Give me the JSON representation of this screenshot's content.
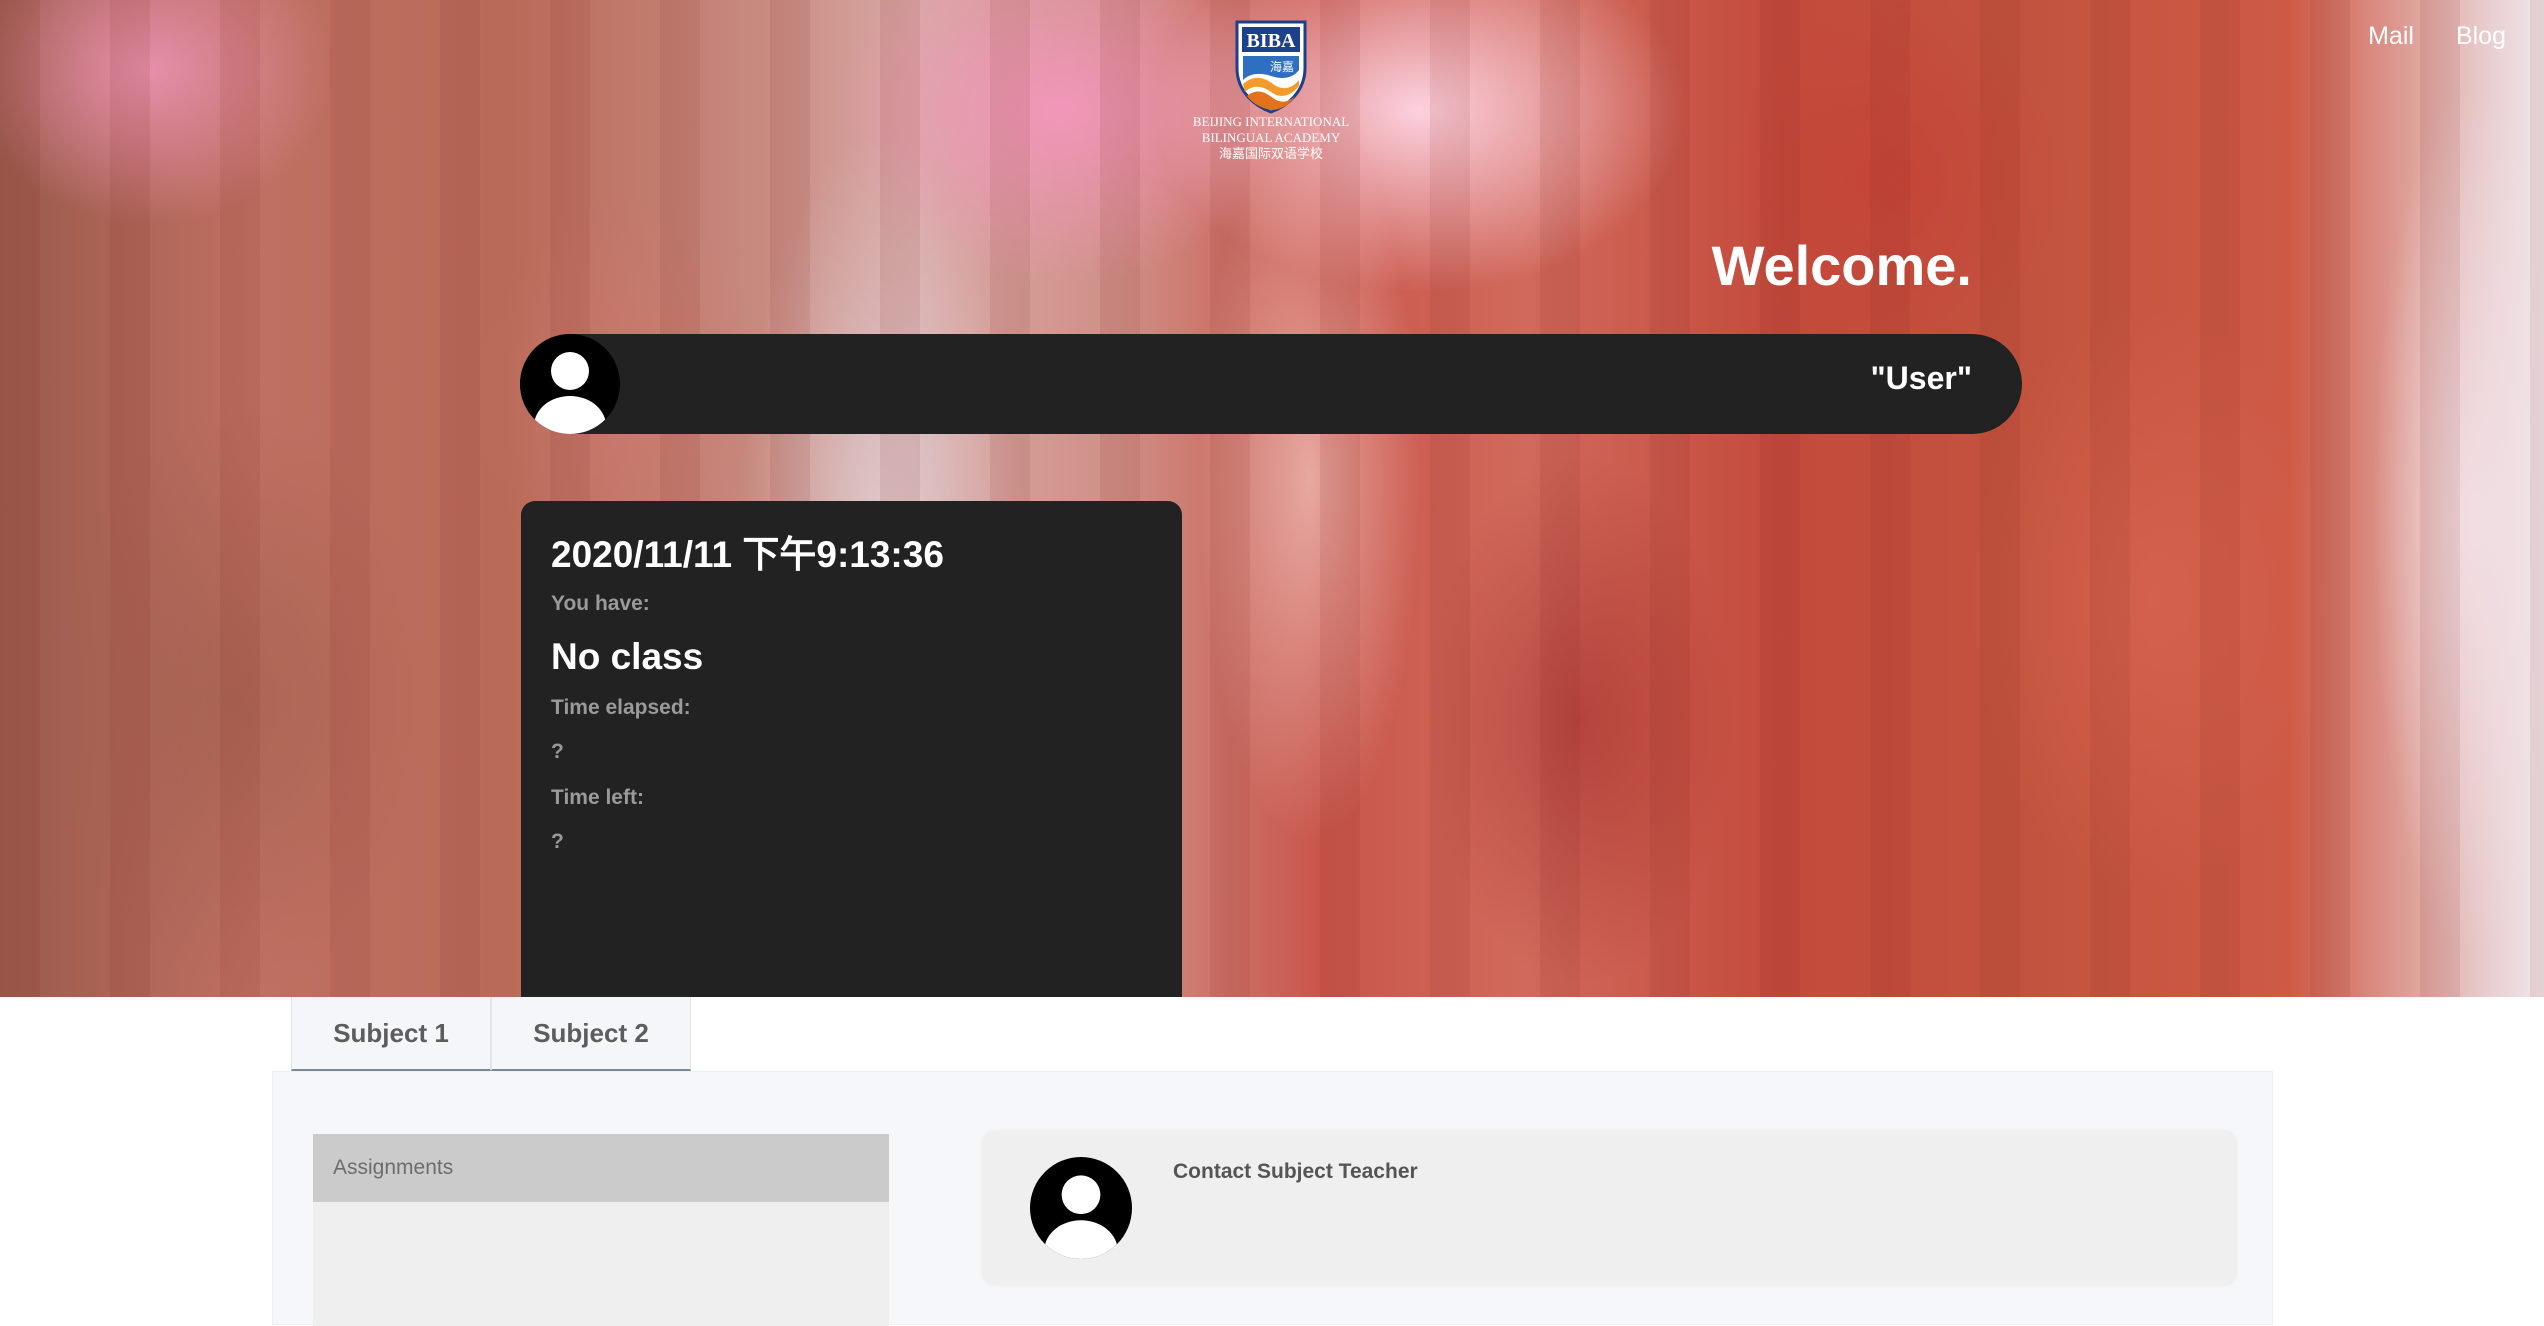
{
  "header": {
    "logo": {
      "mark": "BIBA",
      "mark_cn": "海嘉",
      "line1": "BEIJING INTERNATIONAL",
      "line2": "BILINGUAL ACADEMY",
      "line3": "海嘉国际双语学校"
    },
    "nav": [
      {
        "label": "Mail",
        "icon": "mail-link"
      },
      {
        "label": "Blog",
        "icon": "blog-link"
      }
    ]
  },
  "hero": {
    "welcome": "Welcome.",
    "user_name": "\"User\"",
    "avatar_icon": "user-avatar-icon"
  },
  "schedule_card": {
    "datetime": "2020/11/11 下午9:13:36",
    "you_have_label": "You have:",
    "current_class": "No class",
    "time_elapsed_label": "Time elapsed:",
    "time_elapsed_value": "?",
    "time_left_label": "Time left:",
    "time_left_value": "?"
  },
  "tabs": [
    {
      "label": "Subject 1"
    },
    {
      "label": "Subject 2"
    }
  ],
  "subject_panel": {
    "assignments_header": "Assignments",
    "contact_title": "Contact Subject Teacher"
  },
  "colors": {
    "card_bg": "#222222",
    "panel_bg": "#f6f7fb",
    "assignments_header_bg": "#cbcbcb",
    "tab_underline": "#7a8a96"
  }
}
